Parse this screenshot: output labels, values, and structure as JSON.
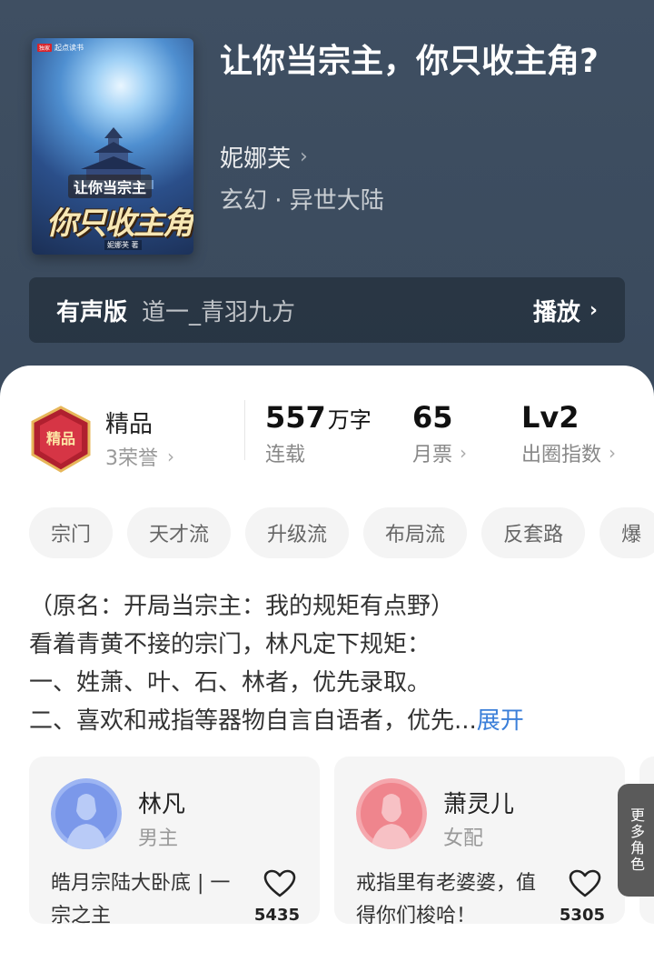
{
  "book": {
    "title": "让你当宗主，你只收主角?",
    "author": "妮娜芙",
    "genre": "玄幻 · 异世大陆"
  },
  "cover": {
    "brand": "起点读书",
    "brand_tag": "独家",
    "title_line1": "让你当宗主",
    "title_line2": "你只收主角?",
    "author": "妮娜芙 著"
  },
  "audio": {
    "label": "有声版",
    "narrator": "道一_青羽九方",
    "play_label": "播放"
  },
  "honor": {
    "badge_text": "精品",
    "title": "精品",
    "subtitle": "3荣誉"
  },
  "stats": [
    {
      "value": "557",
      "unit": "万字",
      "label": "连载"
    },
    {
      "value": "65",
      "unit": "",
      "label": "月票"
    },
    {
      "value": "Lv2",
      "unit": "",
      "label": "出圈指数"
    }
  ],
  "tags": [
    "宗门",
    "天才流",
    "升级流",
    "布局流",
    "反套路",
    "爆"
  ],
  "intro": {
    "lines": [
      "（原名：开局当宗主：我的规矩有点野）",
      "看着青黄不接的宗门，林凡定下规矩：",
      "一、姓萧、叶、石、林者，优先录取。",
      "二、喜欢和戒指等器物自言自语者，优先..."
    ],
    "expand_label": "展开"
  },
  "characters": [
    {
      "name": "林凡",
      "role": "男主",
      "desc": "皓月宗陆大卧底 | 一宗之主",
      "likes": "5435",
      "color": "#8aa8f0"
    },
    {
      "name": "萧灵儿",
      "role": "女配",
      "desc": "戒指里有老婆婆，值得你们梭哈！",
      "likes": "5305",
      "color": "#f2939a"
    }
  ],
  "more_roles_label": "更多角色",
  "colors": {
    "accent": "#3b7fd9",
    "header_bg": "#3c4c5f"
  }
}
